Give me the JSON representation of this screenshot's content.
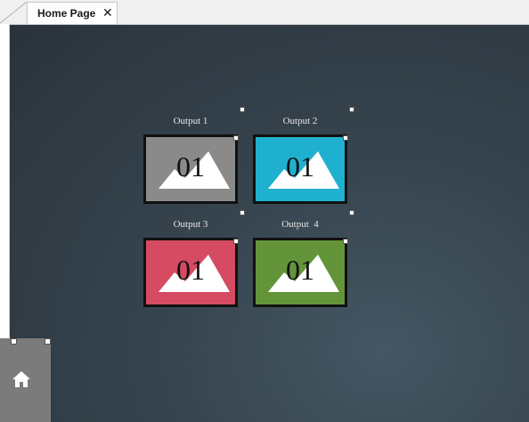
{
  "tabs": [
    {
      "label": "Home Page",
      "close": "✕"
    }
  ],
  "outputs": [
    {
      "label": "Output 1",
      "number": "01",
      "color": "#8a8a8a"
    },
    {
      "label": "Output 2",
      "number": "01",
      "color": "#1fb0cf"
    },
    {
      "label": "Output 3",
      "number": "01",
      "color": "#d44b62"
    },
    {
      "label": "Output  4",
      "number": "01",
      "color": "#63943a"
    }
  ],
  "home": {
    "icon": "home-icon"
  },
  "colors": {
    "canvas_dark": "#2a333b",
    "canvas_light": "#445763",
    "frame": "#111111"
  }
}
